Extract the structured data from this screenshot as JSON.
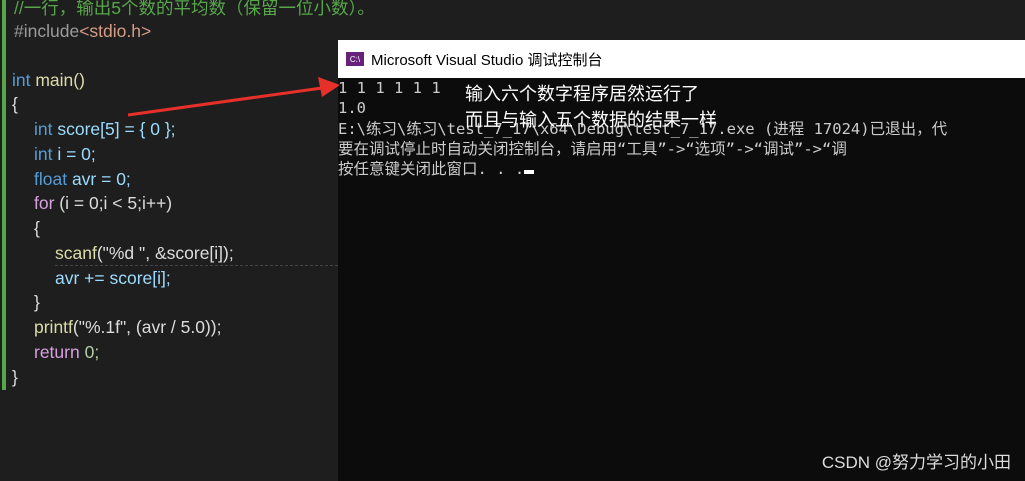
{
  "editor": {
    "comment": "//一行，输出5个数的平均数（保留一位小数）。",
    "lines": [
      [
        "#include",
        "<stdio.h>"
      ],
      [
        "int",
        " main()"
      ],
      [
        "{"
      ],
      [
        "int",
        " score[5] = { 0 };"
      ],
      [
        "int",
        " i = 0;"
      ],
      [
        "float",
        " avr = 0;"
      ],
      [
        "for",
        " (i = 0;i < 5;i++)"
      ],
      [
        "{"
      ],
      [
        "scanf",
        "(\"%d \", &score[i]);"
      ],
      [
        "avr += score[i];"
      ],
      [
        "}"
      ],
      [
        "printf",
        "(\"%.1f\", (avr / 5.0));"
      ],
      [
        "return",
        " 0;"
      ],
      [
        "}"
      ]
    ]
  },
  "console": {
    "title": "Microsoft Visual Studio 调试控制台",
    "icon_text": "C:\\",
    "output": [
      "1 1 1 1 1 1",
      "1.0",
      "E:\\练习\\练习\\test_7_17\\x64\\Debug\\test_7_17.exe (进程 17024)已退出，代",
      "要在调试停止时自动关闭控制台，请启用“工具”->“选项”->“调试”->“调",
      "按任意键关闭此窗口. . ."
    ]
  },
  "annotation": {
    "line1": "输入六个数字程序居然运行了",
    "line2": "而且与输入五个数据的结果一样",
    "color": "#e8302a"
  },
  "watermark": "CSDN @努力学习的小田"
}
